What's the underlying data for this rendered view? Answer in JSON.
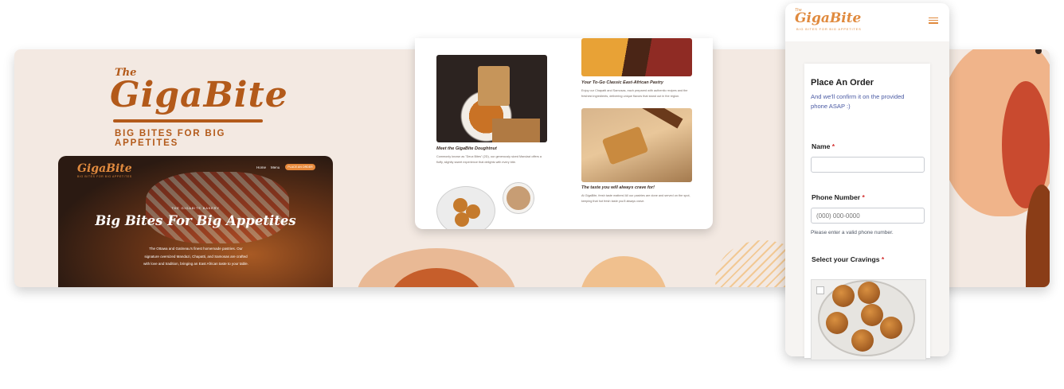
{
  "brand": {
    "the": "The",
    "name": "GigaBite",
    "tagline": "BIG BITES FOR BIG APPETITES"
  },
  "desktop": {
    "logo": "GigaBite",
    "logo_sub": "BIG BITES FOR BIG APPETITES",
    "nav": [
      "Home",
      "Menu"
    ],
    "cta": "PLACE AN ORDER",
    "overline": "THE GIGABITE BAKERY",
    "headline": "Big Bites For Big Appetites",
    "paragraph": "The Ottawa and Gatineau's finest homemade pastries. Our signature oversized Mandazi, Chapatti, and Samosas are crafted with love and tradition, bringing an East African taste to your table."
  },
  "tablet": {
    "items": [
      {
        "caption": "Meet the GigaBite Doughtnut",
        "body": "Commonly known as \"Deux Bites\" (2D), our generously sized Mandazi offers a fluffy, slightly sweet experience that delights with every bite."
      },
      {
        "caption": "Your To-Go Classic East-African Pastry",
        "body": "Enjoy our Chapatti and Samosas, each prepared with authentic recipes and the freshest ingredients, delivering unique flavors that stand out in the region."
      },
      {
        "caption": "The taste you will always crave for!",
        "body": "At GigaBite, fresh taste matters! All our pastries are done and served on the spot, keeping that hot fresh taste you'll always crave."
      }
    ]
  },
  "mobile": {
    "logo_the": "The",
    "logo": "GigaBite",
    "logo_sub": "BIG BITES FOR BIG APPETITES",
    "menu_icon": "hamburger-icon",
    "form": {
      "title": "Place An Order",
      "subtitle": "And we'll confirm it on the provided phone ASAP :)",
      "name_label": "Name",
      "required_mark": "*",
      "name_value": "",
      "phone_label": "Phone Number",
      "phone_placeholder": "(000) 000-0000",
      "phone_help": "Please enter a valid phone number.",
      "cravings_label": "Select your Cravings"
    }
  },
  "colors": {
    "brand_orange": "#b35a1a",
    "accent_orange": "#e08a3e",
    "banner_bg": "#f3e9e2",
    "subtitle_blue": "#4a5aa3",
    "required_red": "#d32f2f"
  }
}
